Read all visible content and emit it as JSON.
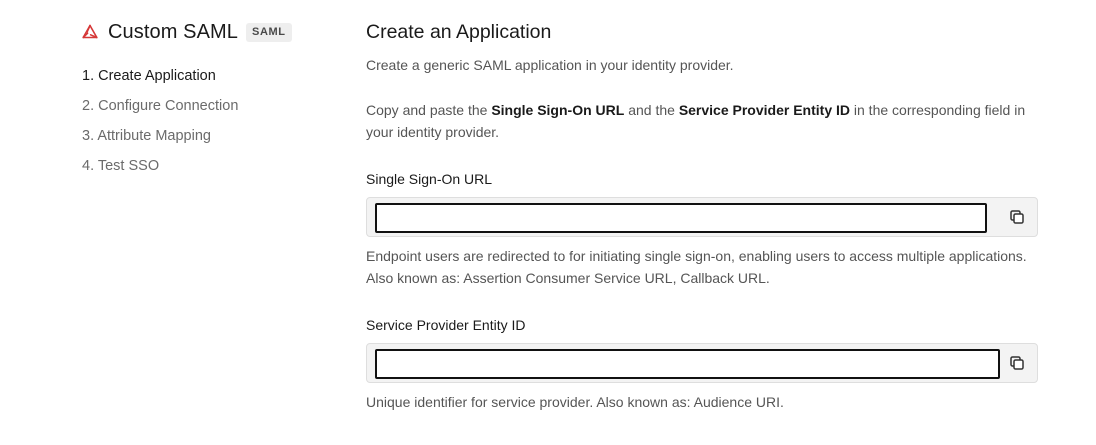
{
  "sidebar": {
    "brand_title": "Custom SAML",
    "brand_badge": "SAML",
    "logo_icon": "saml-triangle-icon",
    "accent_color": "#d63838",
    "steps": [
      {
        "label": "1. Create Application",
        "active": true
      },
      {
        "label": "2. Configure Connection",
        "active": false
      },
      {
        "label": "3. Attribute Mapping",
        "active": false
      },
      {
        "label": "4. Test SSO",
        "active": false
      }
    ]
  },
  "main": {
    "title": "Create an Application",
    "subtitle": "Create a generic SAML application in your identity provider.",
    "instructions": {
      "part1": "Copy and paste the ",
      "bold1": "Single Sign-On URL",
      "part2": " and the ",
      "bold2": "Service Provider Entity ID",
      "part3": " in the corresponding field in your identity provider."
    },
    "fields": {
      "sso_url": {
        "label": "Single Sign-On URL",
        "value": "",
        "copy_icon": "copy-icon",
        "help": "Endpoint users are redirected to for initiating single sign-on, enabling users to access multiple applications. Also known as: Assertion Consumer Service URL, Callback URL."
      },
      "entity_id": {
        "label": "Service Provider Entity ID",
        "value": "",
        "copy_icon": "copy-icon",
        "help": "Unique identifier for service provider. Also known as: Audience URI."
      }
    }
  }
}
